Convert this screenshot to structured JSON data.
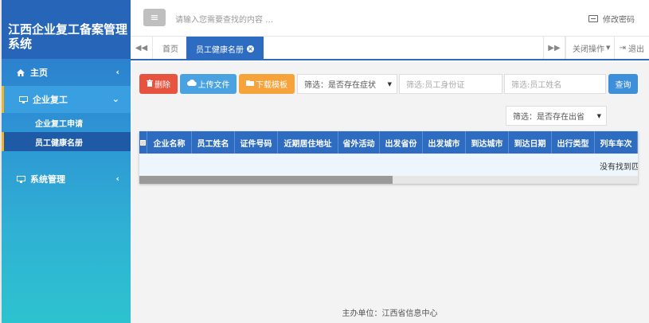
{
  "sidebar": {
    "brand": "江西企业复工备案管理系统",
    "home": "主页",
    "group": "企业复工",
    "sub_items": [
      "企业复工申请",
      "员工健康名册"
    ],
    "system": "系统管理"
  },
  "header": {
    "search_placeholder": "请输入您需要查找的内容 …",
    "change_password": "修改密码"
  },
  "tabs": {
    "home": "首页",
    "active": "员工健康名册",
    "close_ops": "关闭操作",
    "logout": "退出"
  },
  "toolbar": {
    "delete": "删除",
    "upload": "上传文件",
    "download": "下载模板",
    "filter_symptom": "筛选：是否存在症状",
    "id_placeholder": "筛选:员工身份证",
    "name_placeholder": "筛选:员工姓名",
    "query": "查询",
    "filter_province": "筛选：是否存在出省"
  },
  "table": {
    "columns": [
      "企业名称",
      "员工姓名",
      "证件号码",
      "近期居住地址",
      "省外活动",
      "出发省份",
      "出发城市",
      "到达城市",
      "到达日期",
      "出行类型",
      "列车车次"
    ],
    "empty_text": "没有找到匹配"
  },
  "footer": "主办单位：江西省信息中心",
  "colors": {
    "primary": "#2d6cc0",
    "danger": "#e8533f",
    "info": "#4aa3e0",
    "warning": "#f7a33b"
  }
}
